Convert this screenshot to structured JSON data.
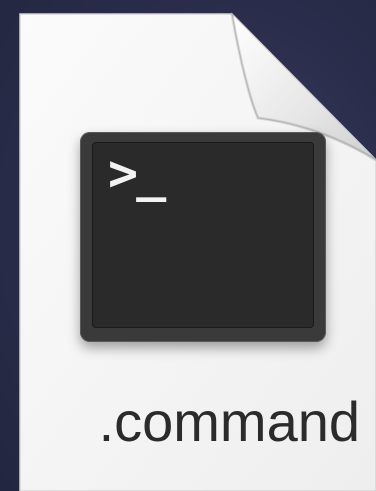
{
  "icon": {
    "name": "command-file-icon",
    "terminal_prompt": ">_",
    "file_extension": ".command"
  },
  "colors": {
    "background": "#2b2f4e",
    "page": "#f7f7f7",
    "terminal_frame": "#3a3a3a",
    "terminal_screen": "#2a2a2a",
    "prompt_text": "#f3f3f3",
    "label_text": "#2b2b2b"
  }
}
